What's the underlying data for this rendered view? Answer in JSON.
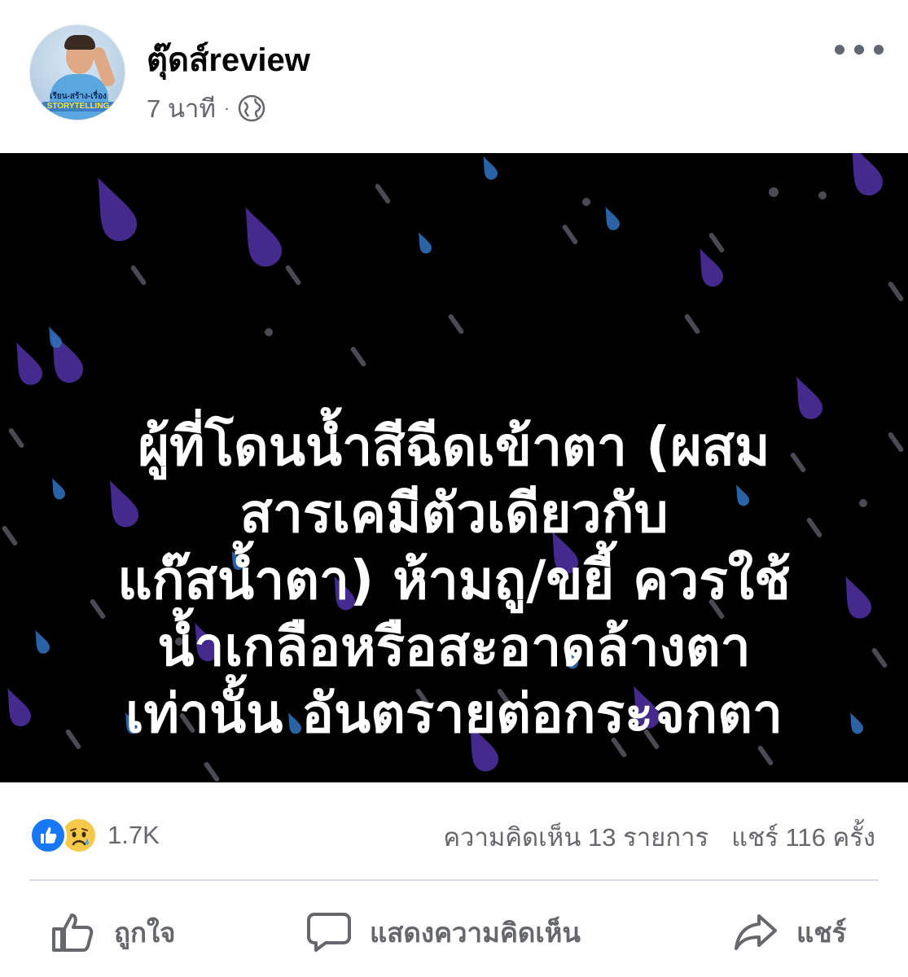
{
  "author": {
    "name": "ตุ๊ดส์review",
    "avatar_caption_top": "เรียน-สร้าง-เรื่อง",
    "avatar_caption_bottom": "STORYTELLING"
  },
  "meta": {
    "time": "7 นาที",
    "separator": "·",
    "audience_icon": "globe-icon"
  },
  "menu": {
    "icon": "more-horizontal-icon"
  },
  "image": {
    "background": "#000000",
    "text_lines": [
      "ผู้ที่โดนน้ำสีฉีดเข้าตา (ผสม",
      "สารเคมีตัวเดียวกับ",
      "แก๊สน้ำตา) ห้ามถู/ขยี้ ควรใช้",
      "น้ำเกลือหรือสะอาดล้างตา",
      "เท่านั้น อันตรายต่อกระจกตา"
    ]
  },
  "stats": {
    "reactions": [
      "like-icon",
      "sad-icon"
    ],
    "reaction_count": "1.7K",
    "comments": "ความคิดเห็น 13 รายการ",
    "shares": "แชร์ 116 ครั้ง"
  },
  "actions": {
    "like_label": "ถูกใจ",
    "comment_label": "แสดงความคิดเห็น",
    "share_label": "แชร์"
  },
  "colors": {
    "like_blue": "#1877f2",
    "muted_text": "#65676b",
    "drop_purple": "#5b3fb0",
    "drop_blue": "#2f6fb8"
  }
}
